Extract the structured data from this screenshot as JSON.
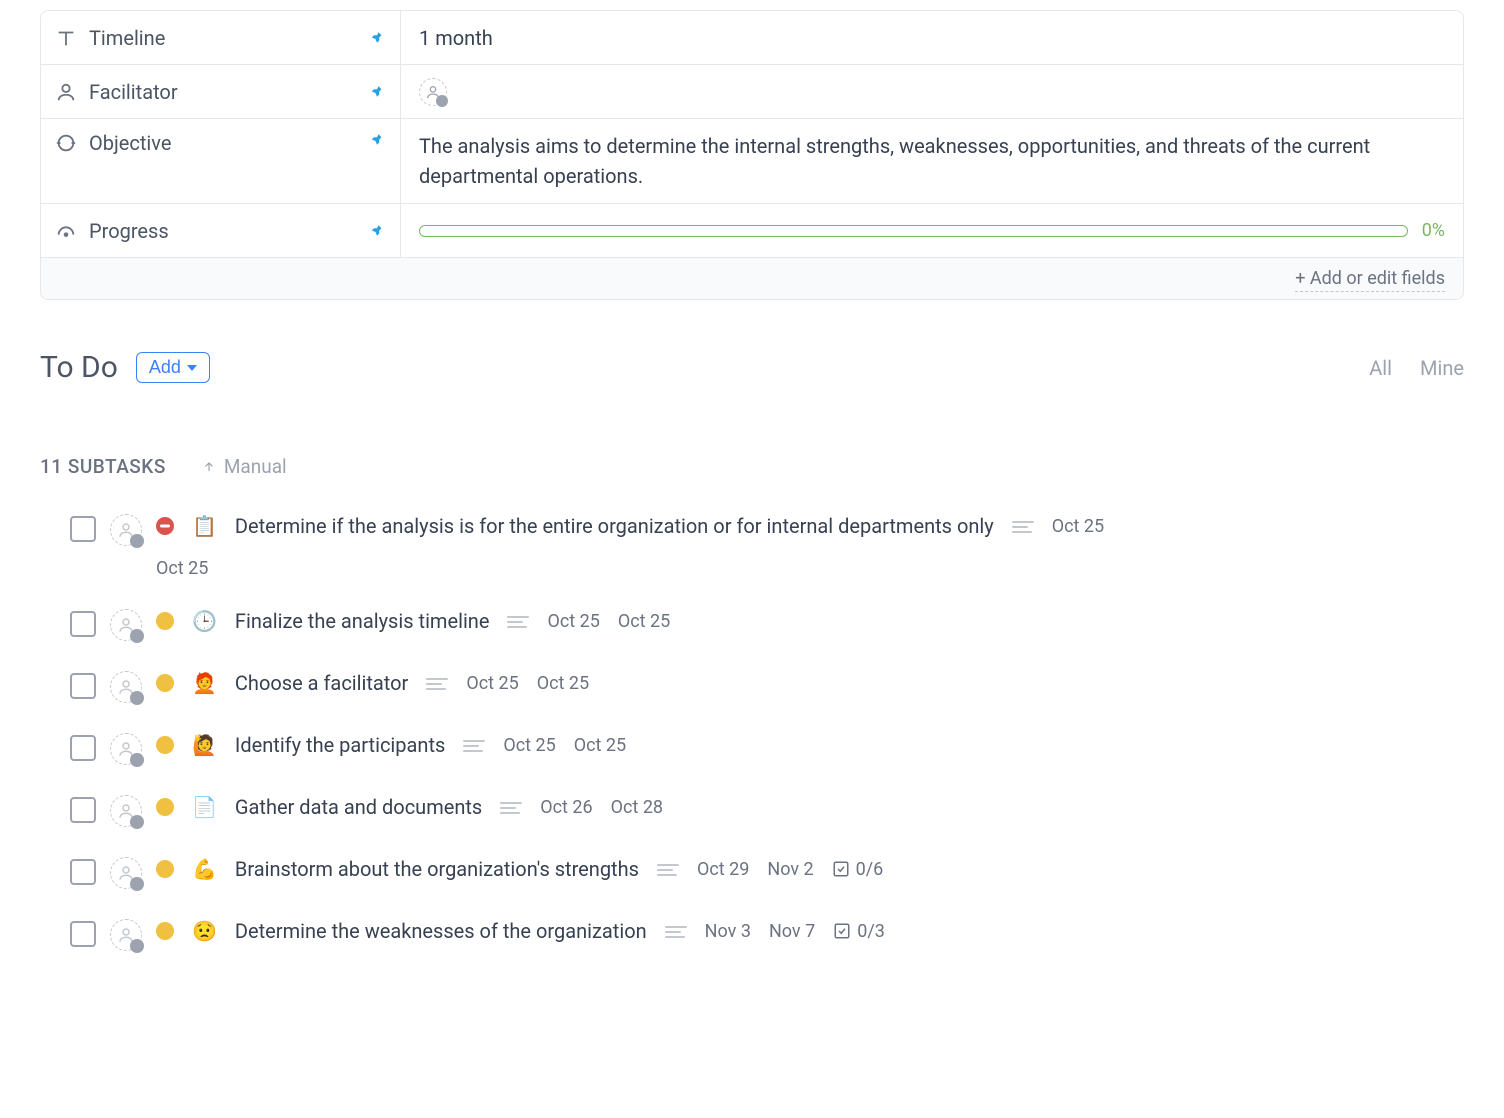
{
  "fields": {
    "timeline": {
      "label": "Timeline",
      "value": "1 month"
    },
    "facilitator": {
      "label": "Facilitator"
    },
    "objective": {
      "label": "Objective",
      "value": "The analysis aims to determine the internal strengths, weaknesses, opportunities, and threats of the current departmental operations."
    },
    "progress": {
      "label": "Progress",
      "value": "0%"
    }
  },
  "add_fields_label": "+ Add or edit fields",
  "todo": {
    "title": "To Do",
    "add_label": "Add",
    "filter_all": "All",
    "filter_mine": "Mine"
  },
  "subtasks": {
    "count_label": "11 SUBTASKS",
    "sort_label": "Manual"
  },
  "tasks": [
    {
      "priority": "high",
      "emoji": "📋",
      "title": "Determine if the analysis is for the entire organization or for internal departments only",
      "date1": "Oct 25",
      "date2": "Oct 25",
      "wrap_date": true
    },
    {
      "priority": "med",
      "emoji": "🕒",
      "title": "Finalize the analysis timeline",
      "date1": "Oct 25",
      "date2": "Oct 25"
    },
    {
      "priority": "med",
      "emoji": "🧑‍🦰",
      "title": "Choose a facilitator",
      "date1": "Oct 25",
      "date2": "Oct 25"
    },
    {
      "priority": "med",
      "emoji": "🙋",
      "title": "Identify the participants",
      "date1": "Oct 25",
      "date2": "Oct 25"
    },
    {
      "priority": "med",
      "emoji": "📄",
      "title": "Gather data and documents",
      "date1": "Oct 26",
      "date2": "Oct 28"
    },
    {
      "priority": "med",
      "emoji": "💪",
      "title": "Brainstorm about the organization's strengths",
      "date1": "Oct 29",
      "date2": "Nov 2",
      "subcount": "0/6"
    },
    {
      "priority": "med",
      "emoji": "😟",
      "title": "Determine the weaknesses of the organization",
      "date1": "Nov 3",
      "date2": "Nov 7",
      "subcount": "0/3"
    }
  ]
}
